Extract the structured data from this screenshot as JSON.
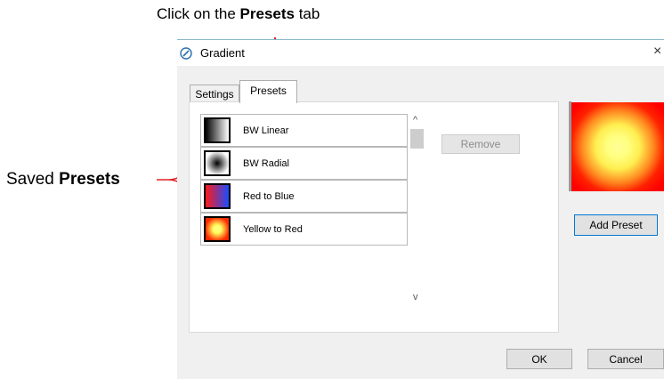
{
  "annotations": {
    "top_prefix": "Click on the ",
    "top_bold": "Presets",
    "top_suffix": " tab",
    "left_prefix": "Saved ",
    "left_bold": "Presets"
  },
  "window": {
    "title": "Gradient",
    "close_glyph": "×"
  },
  "tabs": [
    {
      "label": "Settings",
      "selected": false
    },
    {
      "label": "Presets",
      "selected": true
    }
  ],
  "presets": [
    {
      "label": "BW Linear",
      "swatch": "black-to-white-linear"
    },
    {
      "label": "BW Radial",
      "swatch": "black-to-white-radial"
    },
    {
      "label": "Red to Blue",
      "swatch": "red-to-blue-linear"
    },
    {
      "label": "Yellow to Red",
      "swatch": "yellow-to-red-radial"
    }
  ],
  "scroll": {
    "up_glyph": "^",
    "down_glyph": "v"
  },
  "buttons": {
    "remove": "Remove",
    "add_preset": "Add Preset",
    "ok": "OK",
    "cancel": "Cancel"
  },
  "colors": {
    "arrow": "#e02020",
    "preview_outer": "#ff0000",
    "preview_center": "#ffff96",
    "focus_border": "#0078d7"
  },
  "icons": {
    "title": "gradient-tool-icon"
  }
}
